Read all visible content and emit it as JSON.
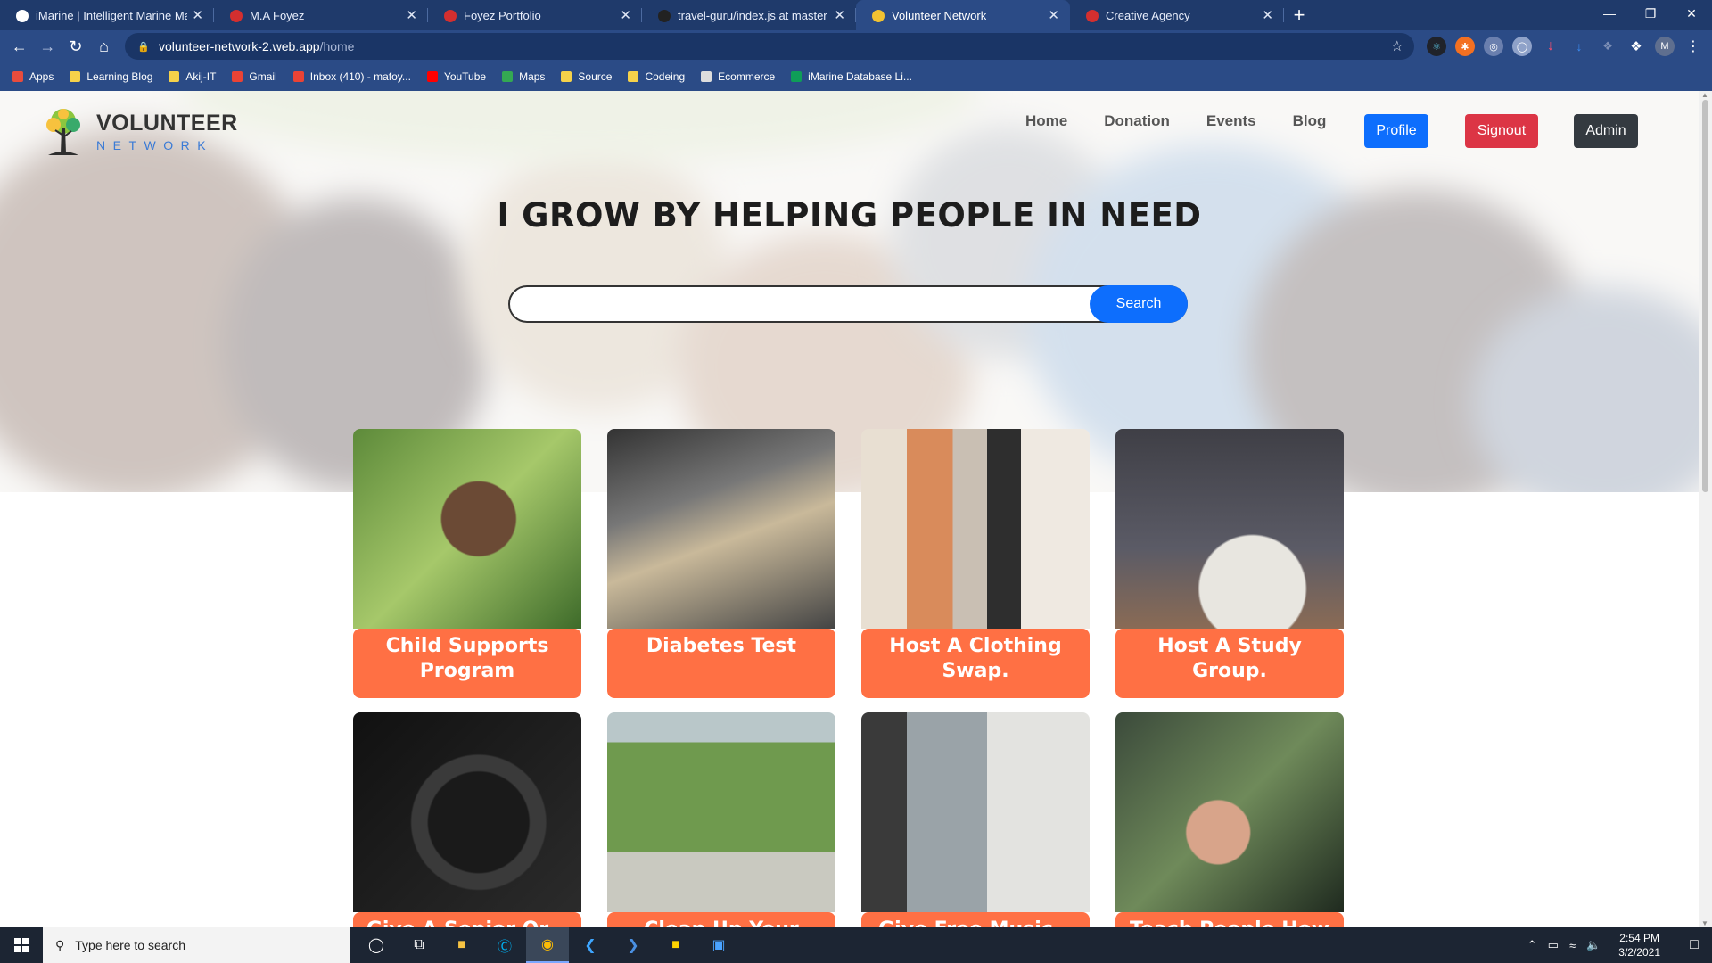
{
  "browser": {
    "tabs": [
      {
        "title": "iMarine | Intelligent Marine Mana",
        "favicon_color": "#ffffff",
        "active": false
      },
      {
        "title": "M.A Foyez",
        "favicon_color": "#d32f2f",
        "active": false
      },
      {
        "title": "Foyez Portfolio",
        "favicon_color": "#d32f2f",
        "active": false
      },
      {
        "title": "travel-guru/index.js at master · m",
        "favicon_color": "#222222",
        "active": false
      },
      {
        "title": "Volunteer Network",
        "favicon_color": "#f1c232",
        "active": true
      },
      {
        "title": "Creative Agency",
        "favicon_color": "#d32f2f",
        "active": false
      }
    ],
    "new_tab_label": "+",
    "url_domain": "volunteer-network-2.web.app",
    "url_path": "/home",
    "bookmarks": [
      {
        "label": "Apps",
        "icon": "apps-grid-icon",
        "color": "#e84c3d"
      },
      {
        "label": "Learning Blog",
        "icon": "folder-icon",
        "color": "#f6d24a"
      },
      {
        "label": "Akij-IT",
        "icon": "folder-icon",
        "color": "#f6d24a"
      },
      {
        "label": "Gmail",
        "icon": "gmail-icon",
        "color": "#ea4335"
      },
      {
        "label": "Inbox (410) - mafoy...",
        "icon": "gmail-icon",
        "color": "#ea4335"
      },
      {
        "label": "YouTube",
        "icon": "youtube-icon",
        "color": "#ff0000"
      },
      {
        "label": "Maps",
        "icon": "maps-icon",
        "color": "#34a853"
      },
      {
        "label": "Source",
        "icon": "folder-icon",
        "color": "#f6d24a"
      },
      {
        "label": "Codeing",
        "icon": "folder-icon",
        "color": "#f6d24a"
      },
      {
        "label": "Ecommerce",
        "icon": "globe-icon",
        "color": "#dddddd"
      },
      {
        "label": "iMarine Database Li...",
        "icon": "sheets-icon",
        "color": "#0f9d58"
      }
    ],
    "profile_initial": "M"
  },
  "site": {
    "logo_title": "VOLUNTEER",
    "logo_subtitle": "NETWORK",
    "nav": [
      "Home",
      "Donation",
      "Events",
      "Blog"
    ],
    "buttons": {
      "profile": "Profile",
      "signout": "Signout",
      "admin": "Admin"
    },
    "headline": "I GROW BY HELPING PEOPLE IN NEED",
    "search": {
      "value": "",
      "button": "Search"
    },
    "cards": [
      {
        "title": "Child Supports Program",
        "photo": "girl-smiling-park-photo"
      },
      {
        "title": "Diabetes Test",
        "photo": "food-bank-hands-photo"
      },
      {
        "title": "Host A Clothing Swap.",
        "photo": "clothing-rack-photo"
      },
      {
        "title": "Host A Study Group.",
        "photo": "people-reading-book-photo"
      },
      {
        "title": "Give A Senior Or…",
        "photo": "car-steering-wheel-photo"
      },
      {
        "title": "Clean Up Your Local…",
        "photo": "city-park-aerial-photo"
      },
      {
        "title": "Give Free Music…",
        "photo": "guitar-room-photo"
      },
      {
        "title": "Teach People How T…",
        "photo": "i-voted-sticker-photo"
      }
    ]
  },
  "taskbar": {
    "search_placeholder": "Type here to search",
    "time": "2:54 PM",
    "date": "3/2/2021"
  }
}
